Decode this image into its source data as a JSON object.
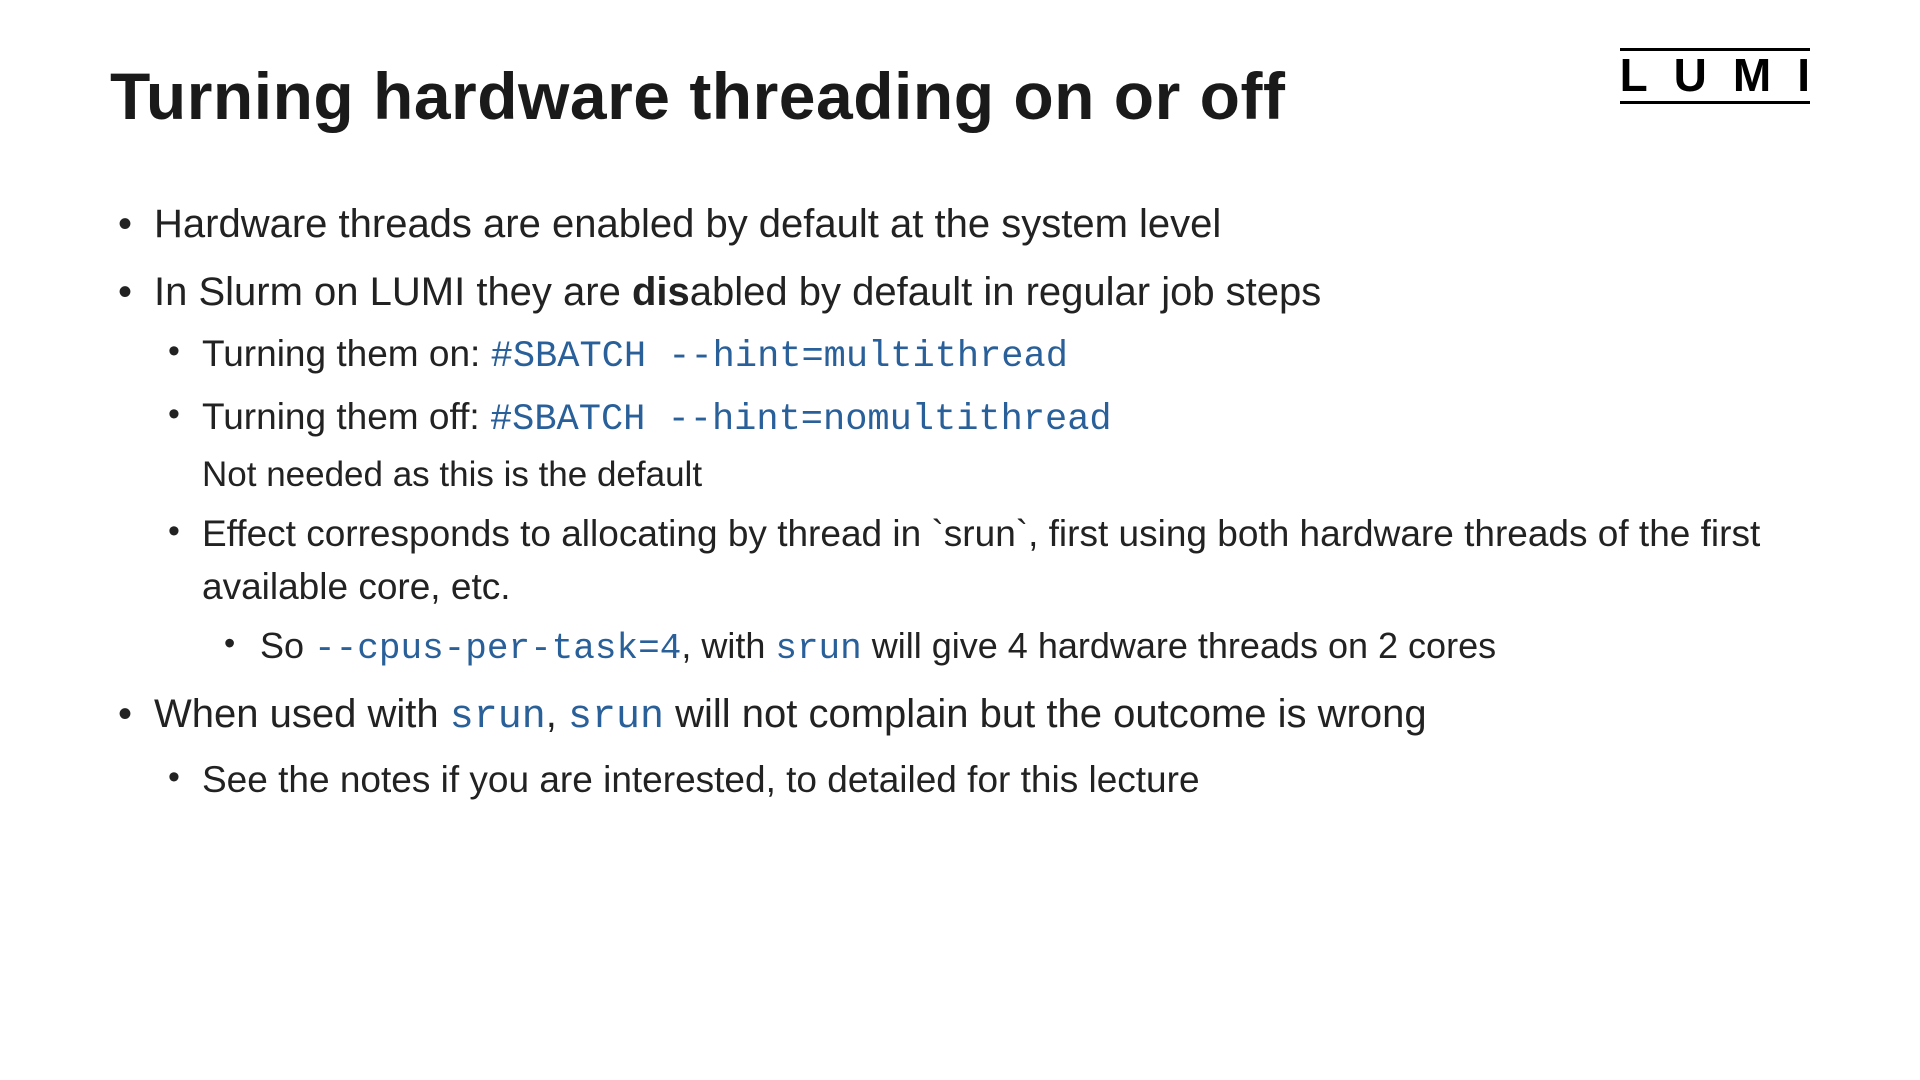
{
  "logo": "LUMI",
  "title": "Turning hardware threading on or off",
  "b1": "Hardware threads are enabled by default at the system level",
  "b2a": "In Slurm on LUMI they are ",
  "b2b": "dis",
  "b2c": "abled by default in regular job steps",
  "b2_1a": "Turning them on: ",
  "b2_1code": "#SBATCH --hint=multithread",
  "b2_2a": "Turning them off: ",
  "b2_2code": "#SBATCH --hint=nomultithread",
  "b2_2note": "Not needed as this is the default",
  "b2_3": "Effect corresponds to allocating by thread in `srun`, first using both hardware threads of the first available core, etc.",
  "b2_3_1a": "So ",
  "b2_3_1code1": "--cpus-per-task=4",
  "b2_3_1b": ", with ",
  "b2_3_1code2": "srun",
  "b2_3_1c": " will give 4 hardware threads on 2 cores",
  "b3a": "When used with ",
  "b3code1": "srun",
  "b3b": ", ",
  "b3code2": "srun",
  "b3c": " will not complain but the outcome is wrong",
  "b3_1": "See the notes if you are interested, to detailed for this lecture"
}
